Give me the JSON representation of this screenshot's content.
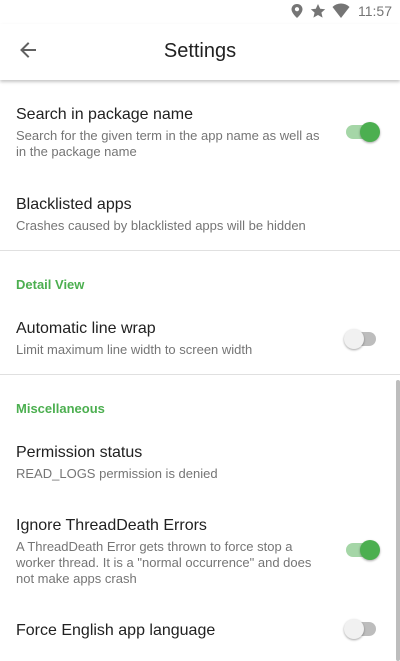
{
  "status_bar": {
    "time": "11:57",
    "icons": [
      "location-icon",
      "star-icon",
      "wifi-icon"
    ]
  },
  "app_bar": {
    "title": "Settings",
    "back_icon": "arrow-left-icon"
  },
  "colors": {
    "accent": "#4caf50",
    "accent_track": "#a5d6a7",
    "text_primary": "#212121",
    "text_secondary": "#757575",
    "divider": "#e0e0e0"
  },
  "preferences": {
    "search_package": {
      "title": "Search in package name",
      "summary": "Search for the given term in the app name as well as in the package name",
      "enabled": true
    },
    "blacklisted": {
      "title": "Blacklisted apps",
      "summary": "Crashes caused by blacklisted apps will be hidden"
    },
    "detail_view_header": "Detail View",
    "line_wrap": {
      "title": "Automatic line wrap",
      "summary": "Limit maximum line width to screen width",
      "enabled": false
    },
    "misc_header": "Miscellaneous",
    "permission": {
      "title": "Permission status",
      "summary": "READ_LOGS permission is denied"
    },
    "threaddeath": {
      "title": "Ignore ThreadDeath Errors",
      "summary": "A ThreadDeath Error gets thrown to force stop a worker thread. It is a \"normal occurrence\" and does not make apps crash",
      "enabled": true
    },
    "force_english": {
      "title": "Force English app language",
      "enabled": false
    }
  }
}
